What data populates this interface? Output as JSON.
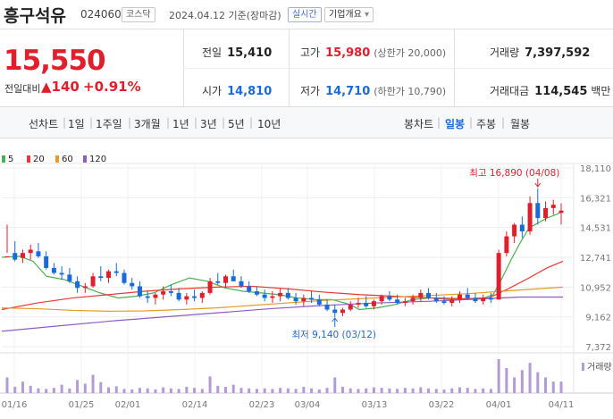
{
  "header": {
    "name": "흥구석유",
    "code": "024060",
    "market": "코스닥",
    "datetime": "2024.04.12  기준(장마감)",
    "realtime": "실시간",
    "overview": "기업개요",
    "overview_arrow": "▾"
  },
  "price": {
    "current": "15,550",
    "change_label": "전일대비",
    "change_arrow": "▲",
    "change_amount": "140",
    "change_pct": "+0.91%"
  },
  "quotes": {
    "prev_label": "전일",
    "prev": "15,410",
    "high_label": "고가",
    "high": "15,980",
    "upper_limit": "(상한가 20,000)",
    "volume_label": "거래량",
    "volume": "7,397,592",
    "open_label": "시가",
    "open": "14,810",
    "low_label": "저가",
    "low": "14,710",
    "lower_limit": "(하한가 10,790)",
    "amount_label": "거래대금",
    "amount": "114,545",
    "amount_unit": "백만"
  },
  "periods": {
    "line_label": "선차트",
    "items": [
      "1일",
      "1주일",
      "3개월",
      "1년",
      "3년",
      "5년",
      "10년"
    ],
    "candle_label": "봉차트",
    "candle_items": [
      "일봉",
      "주봉",
      "월봉"
    ],
    "active_candle": "일봉"
  },
  "colors": {
    "up": "#e01f2d",
    "down": "#1a6ad8",
    "ma5": "#4caf50",
    "ma20": "#e53935",
    "ma60": "#e59a2a",
    "ma120": "#8e5cc2",
    "volume": "#b59bd6"
  },
  "chart_data": {
    "type": "candlestick",
    "legend": [
      {
        "name": "5",
        "color": "#4caf50"
      },
      {
        "name": "20",
        "color": "#e53935"
      },
      {
        "name": "60",
        "color": "#e59a2a"
      },
      {
        "name": "120",
        "color": "#8e5cc2"
      }
    ],
    "y_ticks": [
      "18,110",
      "16,321",
      "14,531",
      "12,741",
      "10,952",
      "9,162",
      "7,372"
    ],
    "ylim": [
      7372,
      18110
    ],
    "x_ticks": [
      "01/16",
      "01/25",
      "02/01",
      "02/14",
      "02/23",
      "03/04",
      "03/13",
      "03/22",
      "04/01",
      "04/11"
    ],
    "annotations": {
      "max": "최고 16,890 (04/08)",
      "min": "최저 9,140 (03/12)"
    },
    "volume_label": "거래량",
    "candles": [
      [
        12741,
        14700,
        13000,
        12800
      ],
      [
        13000,
        13700,
        12500,
        12600
      ],
      [
        12700,
        13200,
        12400,
        13000
      ],
      [
        13000,
        13500,
        12600,
        13200
      ],
      [
        13100,
        13600,
        12700,
        12800
      ],
      [
        12800,
        13100,
        12000,
        12100
      ],
      [
        12100,
        12400,
        11700,
        11800
      ],
      [
        11800,
        12200,
        11400,
        11700
      ],
      [
        11700,
        12100,
        11200,
        11300
      ],
      [
        11300,
        11600,
        10600,
        10900
      ],
      [
        10900,
        11200,
        10600,
        11000
      ],
      [
        11000,
        11800,
        10900,
        11600
      ],
      [
        11600,
        12200,
        11300,
        11500
      ],
      [
        11500,
        12000,
        11200,
        11900
      ],
      [
        11900,
        12400,
        11600,
        11800
      ],
      [
        11800,
        12000,
        11100,
        11200
      ],
      [
        11200,
        11500,
        10800,
        11000
      ],
      [
        11000,
        11300,
        10300,
        10400
      ],
      [
        10400,
        10700,
        10000,
        10300
      ],
      [
        10300,
        10600,
        9900,
        10500
      ],
      [
        10500,
        11000,
        10200,
        10700
      ],
      [
        10700,
        11100,
        10400,
        10600
      ],
      [
        10600,
        10900,
        10100,
        10200
      ],
      [
        10200,
        10600,
        9900,
        10400
      ],
      [
        10400,
        10800,
        10100,
        10300
      ],
      [
        10300,
        10700,
        10000,
        10600
      ],
      [
        10600,
        11500,
        10500,
        11300
      ],
      [
        11300,
        11800,
        11100,
        11200
      ],
      [
        11200,
        11700,
        10900,
        11600
      ],
      [
        11600,
        12000,
        11300,
        11300
      ],
      [
        11300,
        11600,
        10900,
        11000
      ],
      [
        11000,
        11300,
        10600,
        10700
      ],
      [
        10700,
        11000,
        10400,
        10500
      ],
      [
        10500,
        10800,
        10100,
        10300
      ],
      [
        10300,
        10700,
        10000,
        10400
      ],
      [
        10400,
        10900,
        10100,
        10600
      ],
      [
        10600,
        10900,
        10200,
        10300
      ],
      [
        10300,
        10600,
        9900,
        10100
      ],
      [
        10100,
        10500,
        9800,
        10300
      ],
      [
        10300,
        10700,
        10000,
        10200
      ],
      [
        10200,
        10500,
        9800,
        9900
      ],
      [
        9900,
        10200,
        9500,
        9600
      ],
      [
        9600,
        9900,
        9140,
        9400
      ],
      [
        9400,
        9700,
        9200,
        9600
      ],
      [
        9600,
        10100,
        9500,
        9900
      ],
      [
        9900,
        10300,
        9700,
        10000
      ],
      [
        10000,
        10400,
        9700,
        9800
      ],
      [
        9800,
        10200,
        9600,
        10100
      ],
      [
        10100,
        10500,
        9900,
        10400
      ],
      [
        10400,
        10700,
        10100,
        10200
      ],
      [
        10200,
        10500,
        9900,
        10000
      ],
      [
        10000,
        10300,
        9800,
        10100
      ],
      [
        10100,
        10500,
        9900,
        10300
      ],
      [
        10300,
        10800,
        10100,
        10600
      ],
      [
        10600,
        10900,
        10200,
        10300
      ],
      [
        10300,
        10600,
        10000,
        10100
      ],
      [
        10100,
        10400,
        9900,
        10000
      ],
      [
        10000,
        10400,
        9800,
        10200
      ],
      [
        10200,
        10700,
        10000,
        10500
      ],
      [
        10500,
        10900,
        10200,
        10300
      ],
      [
        10300,
        10600,
        10000,
        10100
      ],
      [
        10100,
        10500,
        9900,
        10300
      ],
      [
        10300,
        10600,
        10000,
        10200
      ],
      [
        10200,
        13200,
        10200,
        13000
      ],
      [
        13000,
        14300,
        12800,
        14000
      ],
      [
        14000,
        14800,
        13600,
        14700
      ],
      [
        14700,
        15200,
        13900,
        14300
      ],
      [
        14300,
        16400,
        14100,
        16000
      ],
      [
        16000,
        16890,
        14700,
        15100
      ],
      [
        15100,
        16100,
        14900,
        15700
      ],
      [
        15700,
        16200,
        15300,
        15900
      ],
      [
        15410,
        15980,
        14710,
        15550
      ]
    ],
    "volumes": [
      30,
      12,
      22,
      14,
      9,
      8,
      10,
      16,
      9,
      25,
      18,
      35,
      21,
      11,
      13,
      8,
      7,
      10,
      9,
      7,
      11,
      9,
      8,
      12,
      10,
      8,
      32,
      14,
      12,
      16,
      10,
      9,
      8,
      9,
      8,
      10,
      9,
      8,
      12,
      9,
      7,
      10,
      30,
      12,
      9,
      8,
      9,
      11,
      10,
      9,
      8,
      10,
      9,
      11,
      9,
      8,
      7,
      9,
      11,
      10,
      8,
      9,
      8,
      65,
      48,
      30,
      44,
      58,
      40,
      30,
      22,
      22
    ],
    "ma": {
      "5": [
        [
          0,
          12741
        ],
        [
          20,
          12800
        ],
        [
          35,
          12500
        ],
        [
          50,
          11600
        ],
        [
          70,
          11400
        ],
        [
          90,
          11000
        ],
        [
          110,
          10600
        ],
        [
          130,
          10300
        ],
        [
          150,
          10400
        ],
        [
          170,
          10600
        ],
        [
          190,
          11100
        ],
        [
          210,
          11500
        ],
        [
          230,
          11300
        ],
        [
          250,
          10900
        ],
        [
          270,
          10700
        ],
        [
          290,
          10600
        ],
        [
          310,
          10500
        ],
        [
          330,
          10300
        ],
        [
          350,
          10200
        ],
        [
          370,
          10200
        ],
        [
          390,
          9900
        ],
        [
          400,
          9600
        ],
        [
          420,
          9700
        ],
        [
          440,
          9900
        ],
        [
          460,
          10200
        ],
        [
          480,
          10300
        ],
        [
          500,
          10200
        ],
        [
          520,
          10250
        ],
        [
          540,
          10300
        ],
        [
          550,
          10500
        ],
        [
          560,
          11500
        ],
        [
          570,
          12600
        ],
        [
          580,
          13600
        ],
        [
          590,
          14500
        ],
        [
          600,
          14800
        ],
        [
          610,
          15100
        ],
        [
          620,
          15300
        ],
        [
          628,
          15500
        ]
      ],
      "20": [
        [
          0,
          9600
        ],
        [
          40,
          10000
        ],
        [
          80,
          10300
        ],
        [
          120,
          10500
        ],
        [
          160,
          10700
        ],
        [
          200,
          10850
        ],
        [
          240,
          10950
        ],
        [
          280,
          11000
        ],
        [
          320,
          10850
        ],
        [
          360,
          10650
        ],
        [
          400,
          10500
        ],
        [
          440,
          10400
        ],
        [
          480,
          10300
        ],
        [
          520,
          10250
        ],
        [
          545,
          10300
        ],
        [
          565,
          10800
        ],
        [
          590,
          11500
        ],
        [
          610,
          12100
        ],
        [
          628,
          12500
        ]
      ],
      "60": [
        [
          0,
          9700
        ],
        [
          40,
          9650
        ],
        [
          80,
          9550
        ],
        [
          120,
          9500
        ],
        [
          160,
          9520
        ],
        [
          200,
          9600
        ],
        [
          240,
          9700
        ],
        [
          280,
          9850
        ],
        [
          320,
          10000
        ],
        [
          360,
          10150
        ],
        [
          400,
          10250
        ],
        [
          440,
          10350
        ],
        [
          480,
          10450
        ],
        [
          520,
          10550
        ],
        [
          560,
          10700
        ],
        [
          600,
          10850
        ],
        [
          628,
          10950
        ]
      ],
      "120": [
        [
          0,
          8300
        ],
        [
          60,
          8600
        ],
        [
          120,
          8900
        ],
        [
          180,
          9150
        ],
        [
          240,
          9400
        ],
        [
          300,
          9650
        ],
        [
          360,
          9850
        ],
        [
          420,
          10000
        ],
        [
          480,
          10100
        ],
        [
          540,
          10250
        ],
        [
          580,
          10350
        ],
        [
          628,
          10350
        ]
      ]
    }
  }
}
